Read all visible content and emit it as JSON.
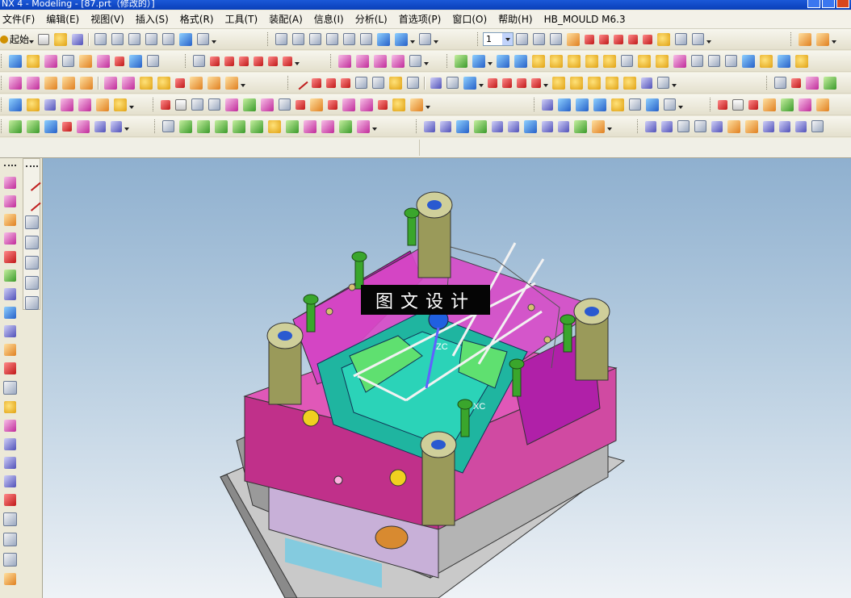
{
  "window": {
    "title": "NX 4 - Modeling - [87.prt（修改的）]"
  },
  "menubar": {
    "items": [
      "文件(F)",
      "编辑(E)",
      "视图(V)",
      "插入(S)",
      "格式(R)",
      "工具(T)",
      "装配(A)",
      "信息(I)",
      "分析(L)",
      "首选项(P)",
      "窗口(O)",
      "帮助(H)",
      "HB_MOULD M6.3"
    ]
  },
  "toolbar": {
    "start_label": "起始",
    "layer_value": "1"
  },
  "viewport": {
    "watermark": "图文设计",
    "axis_z": "ZC",
    "axis_x": "XC",
    "colors": {
      "bg_top": "#8fb0cf",
      "plate_magenta": "#e058b8",
      "insert_teal": "#1fb5a0",
      "pillar_olive": "#9a9a5a",
      "bolt_green": "#3aa62c",
      "spring_orange": "#d88a30",
      "base_gray": "#9a9a9a"
    }
  }
}
